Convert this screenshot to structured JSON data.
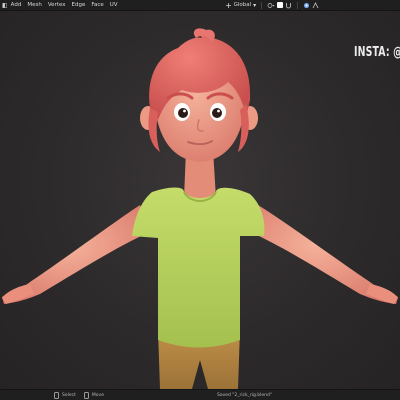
{
  "topbar": {
    "menu": [
      "◧",
      "Add",
      "Mesh",
      "Vertex",
      "Edge",
      "Face",
      "UV"
    ],
    "orientation": "Global"
  },
  "viewport": {
    "watermark": "INSTA: @"
  },
  "statusbar": {
    "select": "Select",
    "move": "Move",
    "saved": "Saved \"2_rick_rig.blend\""
  },
  "icons": [
    "mode-icon",
    "transform-orientation-icon",
    "pivot-icon",
    "snap-icon",
    "magnet-icon",
    "proportional-icon",
    "overlay-icon",
    "mouse-icon"
  ],
  "colors": {
    "background": "#2a2829",
    "hair": "#e46a65",
    "skin": "#ec9a84",
    "shirt": "#b8d35c",
    "pants": "#b58a43"
  }
}
